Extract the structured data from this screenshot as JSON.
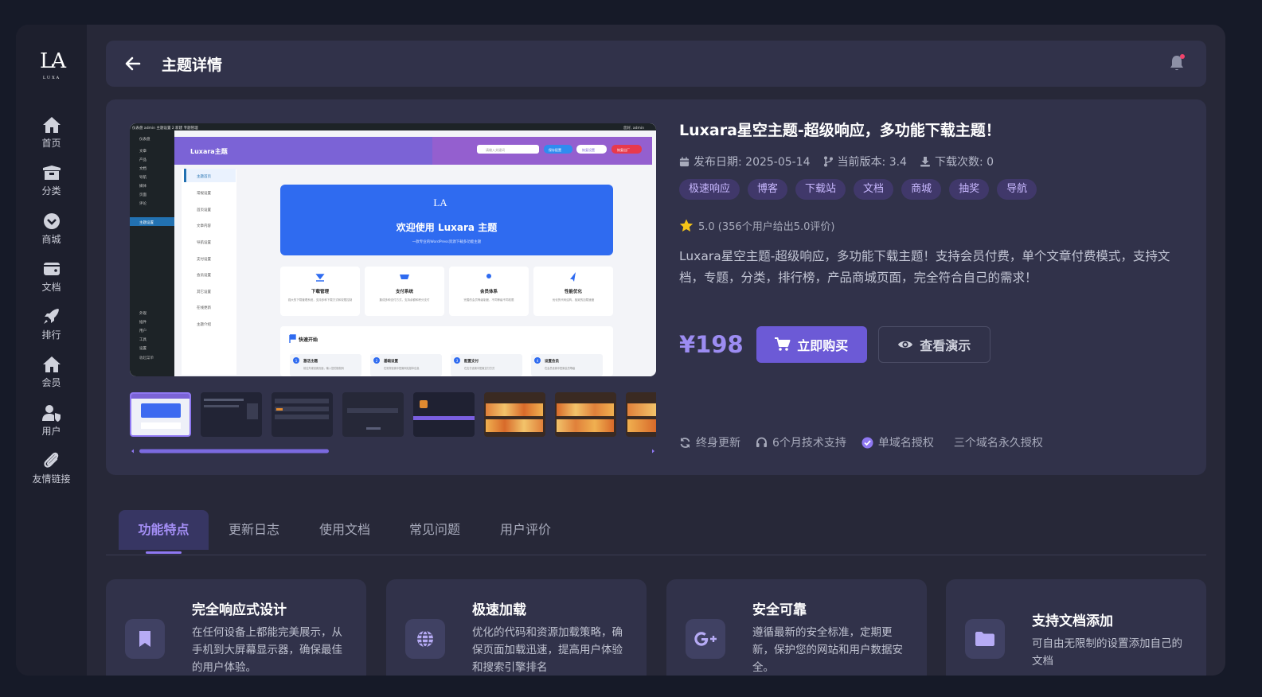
{
  "sidebar": {
    "logo": "LA",
    "logo_sub": "LUXA",
    "items": [
      {
        "label": "首页",
        "icon": "home-icon"
      },
      {
        "label": "分类",
        "icon": "box-icon"
      },
      {
        "label": "商城",
        "icon": "chevron-circle-icon"
      },
      {
        "label": "文档",
        "icon": "wallet-icon"
      },
      {
        "label": "排行",
        "icon": "rocket-icon"
      },
      {
        "label": "会员",
        "icon": "home-icon"
      },
      {
        "label": "用户",
        "icon": "user-shield-icon"
      },
      {
        "label": "友情链接",
        "icon": "paperclip-icon"
      }
    ]
  },
  "header": {
    "title": "主题详情"
  },
  "product": {
    "title": "Luxara星空主题-超级响应，多功能下载主题！",
    "release_label": "发布日期: 2025-05-14",
    "version_label": "当前版本: 3.4",
    "downloads_label": "下载次数: 0",
    "tags": [
      "极速响应",
      "博客",
      "下载站",
      "文档",
      "商城",
      "抽奖",
      "导航"
    ],
    "rating_text": "5.0 (356个用户给出5.0评价)",
    "description": "Luxara星空主题-超级响应，多功能下载主题！支持会员付费，单个文章付费模式，支持文档，专题，分类，排行榜，产品商城页面，完全符合自己的需求！",
    "price": "¥198",
    "buy_label": "立即购买",
    "demo_label": "查看演示",
    "features": [
      "终身更新",
      "6个月技术支持",
      "单域名授权",
      "三个域名永久授权"
    ]
  },
  "preview": {
    "adminbar_left": "仪表盘  admin  主题设置  2  新建  专题管理",
    "adminbar_right": "您好, admin",
    "brand": "Luxara主题",
    "search_placeholder": "请输入关键词",
    "btn1": "保存配置",
    "btn2": "恢复设置",
    "btn3": "恢复出厂",
    "sub_menu": [
      "主题首页",
      "常规设置",
      "首页设置",
      "文章内容",
      "导航设置",
      "支付设置",
      "会员设置",
      "其它设置",
      "在线更新",
      "主题介绍"
    ],
    "left_menu": [
      "仪表盘",
      "文章",
      "产品",
      "文档",
      "导航",
      "媒体",
      "页面",
      "评论",
      "主题设置"
    ],
    "left_menu2": [
      "外观",
      "插件",
      "用户",
      "工具",
      "设置",
      "收起菜单"
    ],
    "banner_title": "欢迎使用 Luxara 主题",
    "banner_sub": "一款专业的WordPress资源下载多功能主题",
    "cards": [
      {
        "title": "下载管理",
        "text": "强大的下载管理系统，支持多种下载方式和权限控制"
      },
      {
        "title": "支付系统",
        "text": "集成多种支付方式，支持余额和积分支付"
      },
      {
        "title": "会员体系",
        "text": "完善的会员等级制度，不同等级不同权限"
      },
      {
        "title": "性能优化",
        "text": "优化的代码结构，极致的加载速度"
      }
    ],
    "quick_title": "快速开始",
    "steps": [
      {
        "n": "1",
        "title": "激活主题",
        "text": "前往外观设置页面，输入您的授权码"
      },
      {
        "n": "2",
        "title": "基础设置",
        "text": "在常规设置中配置网站基本信息"
      },
      {
        "n": "3",
        "title": "配置支付",
        "text": "在支付设置中配置支付方式"
      },
      {
        "n": "4",
        "title": "设置会员",
        "text": "在会员设置中配置会员等级"
      }
    ],
    "thumb_count": 8,
    "thumb_active": 0
  },
  "tabs": [
    "功能特点",
    "更新日志",
    "使用文档",
    "常见问题",
    "用户评价"
  ],
  "active_tab": 0,
  "feature_cards": [
    {
      "title": "完全响应式设计",
      "text": "在任何设备上都能完美展示，从手机到大屏幕显示器，确保最佳的用户体验。",
      "icon": "bookmark-icon"
    },
    {
      "title": "极速加载",
      "text": "优化的代码和资源加载策略，确保页面加载迅速，提高用户体验和搜索引擎排名",
      "icon": "globe-icon"
    },
    {
      "title": "安全可靠",
      "text": "遵循最新的安全标准，定期更新，保护您的网站和用户数据安全。",
      "icon": "google-plus-icon"
    },
    {
      "title": "支持文档添加",
      "text": "可自由无限制的设置添加自己的文档",
      "icon": "folder-icon"
    }
  ],
  "colors": {
    "accent": "#6c5ad6",
    "price": "#9c8cf2",
    "tag_bg": "#40386a",
    "tag_text": "#c8b8ff"
  }
}
